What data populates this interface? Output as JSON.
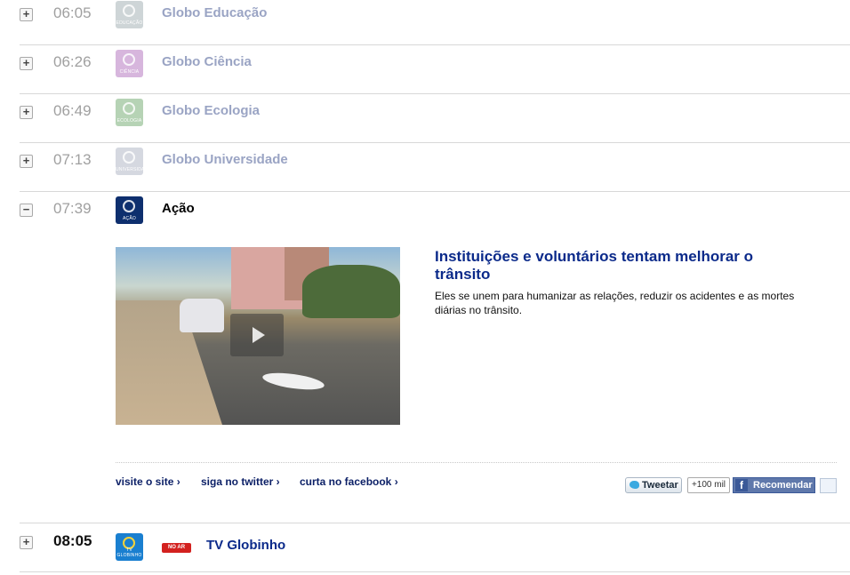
{
  "schedule": [
    {
      "toggle": "+",
      "time": "06:05",
      "title": "Globo Educação",
      "logo_caption": "EDUCAÇÃO",
      "logo_color": "#a7b4b7"
    },
    {
      "toggle": "+",
      "time": "06:26",
      "title": "Globo Ciência",
      "logo_caption": "CIÊNCIA",
      "logo_color": "#b77cc3"
    },
    {
      "toggle": "+",
      "time": "06:49",
      "title": "Globo Ecologia",
      "logo_caption": "ECOLOGIA",
      "logo_color": "#7bb07a"
    },
    {
      "toggle": "+",
      "time": "07:13",
      "title": "Globo Universidade",
      "logo_caption": "UNIVERSIDADE",
      "logo_color": "#b4b9c8"
    }
  ],
  "current": {
    "toggle": "−",
    "time": "07:39",
    "title": "Ação",
    "logo_caption": "AÇÃO",
    "logo_color": "#0e2f6e",
    "headline": "Instituições e voluntários tentam melhorar o trânsito",
    "description": "Eles se unem para humanizar as relações, reduzir os acidentes e as mortes diárias no trânsito.",
    "links": {
      "site": "visite o site ›",
      "twitter": "siga no twitter ›",
      "facebook": "curta no facebook ›"
    },
    "social": {
      "tweet": "Tweetar",
      "count": "+100 mil",
      "recommend": "Recomendar"
    }
  },
  "next": {
    "toggle": "+",
    "time": "08:05",
    "title": "TV Globinho",
    "badge": "NO AR",
    "logo_caption": "TV GLOBINHO",
    "logo_color": "#1a7fd0"
  }
}
